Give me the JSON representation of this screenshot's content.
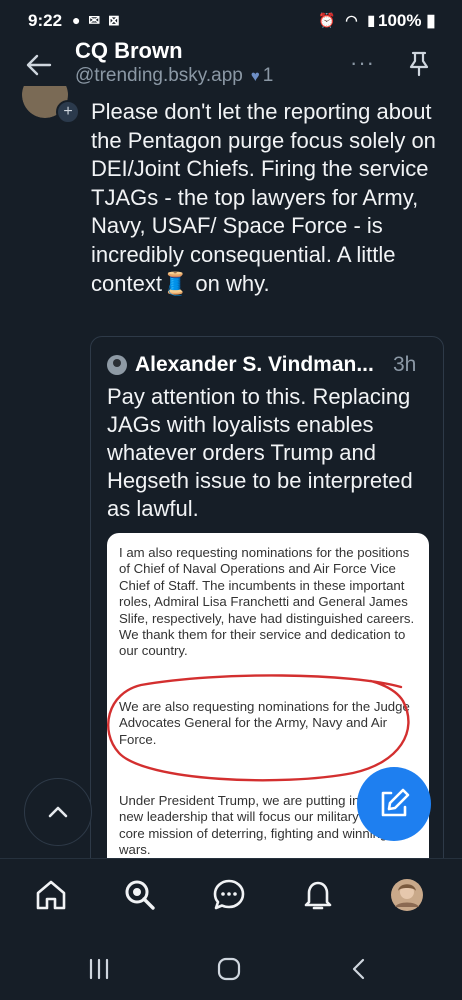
{
  "status": {
    "time": "9:22",
    "battery": "100%"
  },
  "header": {
    "title": "CQ Brown",
    "handle": "@trending.bsky.app",
    "likes": "1"
  },
  "post": {
    "text": "Please don't let the reporting about the Pentagon purge focus solely on DEI/Joint Chiefs. Firing the service TJAGs - the top lawyers for Army, Navy, USAF/ Space Force - is incredibly consequential. A little context🧵 on why."
  },
  "quote": {
    "author": "Alexander S. Vindman...",
    "time": "3h",
    "text": "Pay attention to this. Replacing JAGs with loyalists enables whatever orders Trump and Hegseth issue to be interpreted as lawful.",
    "doc": {
      "p1": "I am also requesting nominations for the positions of Chief of Naval Operations and Air Force Vice Chief of Staff. The incumbents in these important roles, Admiral Lisa Franchetti and General James Slife, respectively, have had distinguished careers. We thank them for their service and dedication to our country.",
      "p2": "We are also requesting nominations for the Judge Advocates General for the Army, Navy and Air Force.",
      "p3": "Under President Trump, we are putting in place new leadership that will focus our military on its core mission of deterring, fighting and winning wars."
    }
  },
  "colors": {
    "accent": "#1e7ff0",
    "background": "#161e27",
    "annotation": "#d32f2f"
  },
  "nav": {
    "items": [
      "home-icon",
      "search-icon",
      "chat-icon",
      "notifications-icon",
      "profile-avatar"
    ]
  }
}
